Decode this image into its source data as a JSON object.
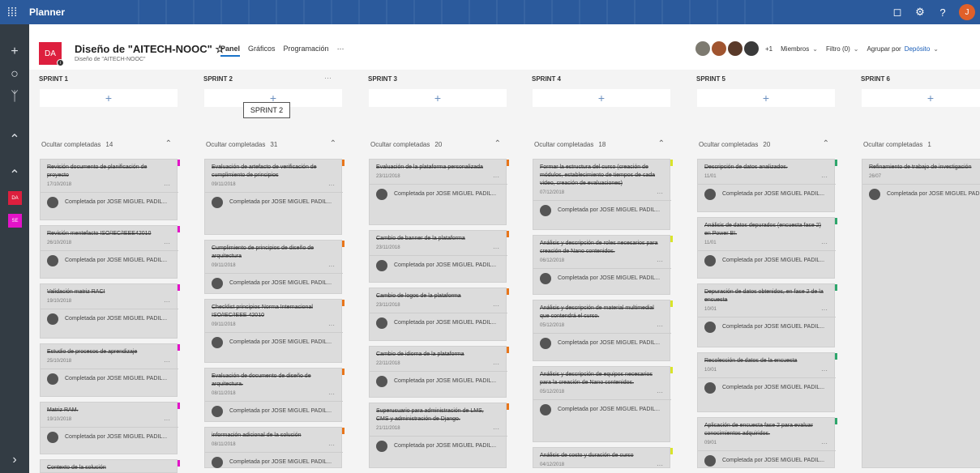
{
  "app": {
    "name": "Planner",
    "waffle": "waffle-icon",
    "user_initial": "J"
  },
  "plan": {
    "tile": "DA",
    "title": "Diseño de \"AITECH-NOOC\" ☆",
    "subtitle": "Diseño de \"AITECH-NOOC\"",
    "tabs": [
      "Panel",
      "Gráficos",
      "Programación",
      "···"
    ],
    "members_more": "+1",
    "members_label": "Miembros",
    "filter_label": "Filtro (0)",
    "group_label": "Agrupar por",
    "group_value": "Depósito"
  },
  "rail": {
    "badges": [
      "DA",
      "SE"
    ]
  },
  "tooltip": "SPRINT 2",
  "hide_label": "Ocultar completadas",
  "completed_by": "Completada por JOSE MIGUEL PADIL...",
  "colors": {
    "magenta": "#e313c8",
    "orange": "#e8751a",
    "yellow": "#d9e42a",
    "green": "#2ea66c",
    "red": "#dd1f3e"
  },
  "buckets": [
    {
      "name": "SPRINT 1",
      "count": "14",
      "more": "",
      "color": "#e313c8",
      "cards": [
        {
          "title": "Revisión documento de planificación de proyecto",
          "date": "17/10/2018"
        },
        {
          "title": "Revisión mentefacto ISO/IEC/IEEE42010",
          "date": "26/10/2018"
        },
        {
          "title": "Validación matriz RACI",
          "date": "19/10/2018"
        },
        {
          "title": "Estudio de procesos de aprendizaje",
          "date": "25/10/2018"
        },
        {
          "title": "Matriz RAM.",
          "date": "19/10/2018"
        },
        {
          "title": "Contexto de la solución",
          "date": ""
        }
      ]
    },
    {
      "name": "SPRINT 2",
      "count": "31",
      "more": "···",
      "color": "#e8751a",
      "cards": [
        {
          "title": "Evaluación de artefacto de verificación de cumplimiento de principios",
          "date": "09/11/2018"
        },
        {
          "title": "Cumplimiento de principios de diseño de arquitectura",
          "date": "09/11/2018"
        },
        {
          "title": "Checklist principios Norma Internacional ISO/IEC/IEEE 42010",
          "date": "09/11/2018"
        },
        {
          "title": "Evaluación de documento de diseño de arquitectura.",
          "date": "08/11/2018"
        },
        {
          "title": "información adicional de la solución",
          "date": "08/11/2018"
        }
      ]
    },
    {
      "name": "SPRINT 3",
      "count": "20",
      "more": "",
      "color": "#e8751a",
      "cards": [
        {
          "title": "Evaluación de la plataforma personalizada",
          "date": "23/11/2018"
        },
        {
          "title": "Cambio de banner de la plataforma",
          "date": "23/11/2018"
        },
        {
          "title": "Cambio de logos de la plataforma",
          "date": "23/11/2018"
        },
        {
          "title": "Cambio de idioma de la plataforma",
          "date": "22/11/2018"
        },
        {
          "title": "Superusuario para administración de LMS, CMS y administración de Django.",
          "date": "21/11/2018"
        }
      ]
    },
    {
      "name": "SPRINT 4",
      "count": "18",
      "more": "",
      "color": "#d9e42a",
      "cards": [
        {
          "title": "Formar la estructura del curso (creación de módulos, establecimiento de tiempos de cada video, creación de evaluaciones)",
          "date": "07/12/2018"
        },
        {
          "title": "Análisis y descripción de roles necesarios para creación de Nano contenidos.",
          "date": "06/12/2018"
        },
        {
          "title": "Análisis y descripción de material multimedial que contendrá el curso.",
          "date": "05/12/2018"
        },
        {
          "title": "Análisis y descripción de equipos necesarios para la creación de Nano contenidos.",
          "date": "05/12/2018"
        },
        {
          "title": "Análisis de costo y duración de curso",
          "date": "04/12/2018"
        }
      ]
    },
    {
      "name": "SPRINT 5",
      "count": "20",
      "more": "",
      "color": "#2ea66c",
      "cards": [
        {
          "title": "Descripción de datos analizados.",
          "date": "11/01"
        },
        {
          "title": "Análisis de datos depurados (encuesta fase 2) en Power BI.",
          "date": "11/01"
        },
        {
          "title": "Depuración de datos obtenidos, en fase 2 de la encuesta",
          "date": "10/01"
        },
        {
          "title": "Recolección de datos de la encuesta",
          "date": "10/01"
        },
        {
          "title": "Aplicación de encuesta fase 2 para evaluar conocimientos adquiridos.",
          "date": "09/01"
        }
      ]
    },
    {
      "name": "SPRINT 6",
      "count": "1",
      "more": "",
      "color": "#2ea66c",
      "cards": [
        {
          "title": "Refinamiento de trabajo de investigación",
          "date": "26/07"
        }
      ]
    }
  ]
}
